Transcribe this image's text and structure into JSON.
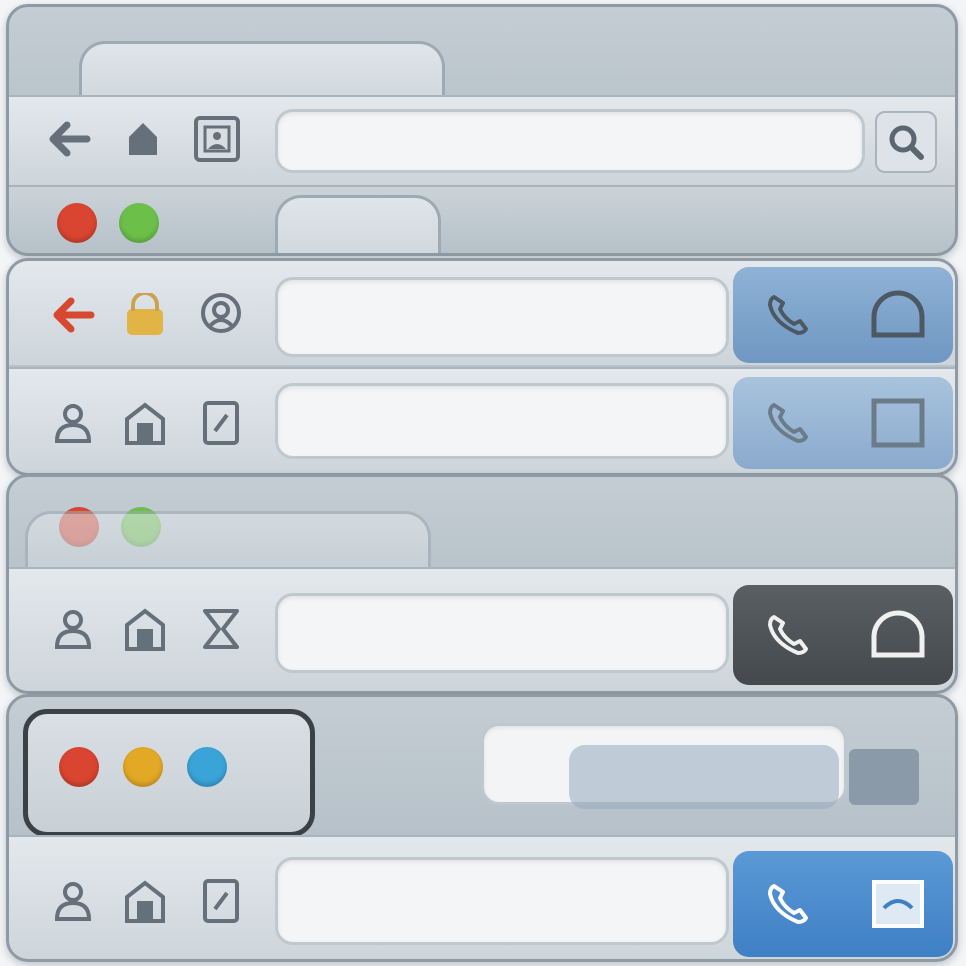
{
  "colors": {
    "dot_red": "#d94530",
    "dot_yellow": "#e3a825",
    "dot_green": "#6cc04a",
    "dot_blue": "#3aa3d8",
    "icon_gray": "#66707a",
    "icon_red": "#d6482f"
  },
  "windows": [
    {
      "name": "window-1",
      "icons": [
        "back-arrow-icon",
        "home-icon",
        "picture-icon"
      ],
      "address": {
        "value": "",
        "placeholder": ""
      },
      "action": "search-icon"
    },
    {
      "name": "window-2",
      "dots": [
        "red",
        "green"
      ]
    },
    {
      "name": "window-3",
      "icons": [
        "back-arrow-icon",
        "lock-icon",
        "avatar-icon"
      ],
      "address": {
        "value": "",
        "placeholder": ""
      },
      "panel_icons": [
        "phone-icon",
        "dome-icon"
      ],
      "panel_style": "blue"
    },
    {
      "name": "window-4",
      "icons": [
        "user-icon",
        "home-icon",
        "document-icon"
      ],
      "address": {
        "value": "",
        "placeholder": ""
      },
      "panel_icons": [
        "phone-icon",
        "square-icon"
      ],
      "panel_style": "light-blue"
    },
    {
      "name": "window-5",
      "dots": [
        "red",
        "green"
      ],
      "icons": [
        "user-icon",
        "home-icon",
        "hourglass-icon"
      ],
      "address": {
        "value": "",
        "placeholder": ""
      },
      "panel_icons": [
        "phone-icon",
        "dome-icon"
      ],
      "panel_style": "dark"
    },
    {
      "name": "window-6",
      "dots": [
        "red",
        "yellow",
        "blue"
      ],
      "icons": [
        "user-icon",
        "home-icon",
        "document-icon"
      ],
      "address": {
        "value": "",
        "placeholder": ""
      },
      "panel_icons": [
        "phone-icon",
        "image-icon"
      ],
      "panel_style": "bright-blue"
    }
  ]
}
